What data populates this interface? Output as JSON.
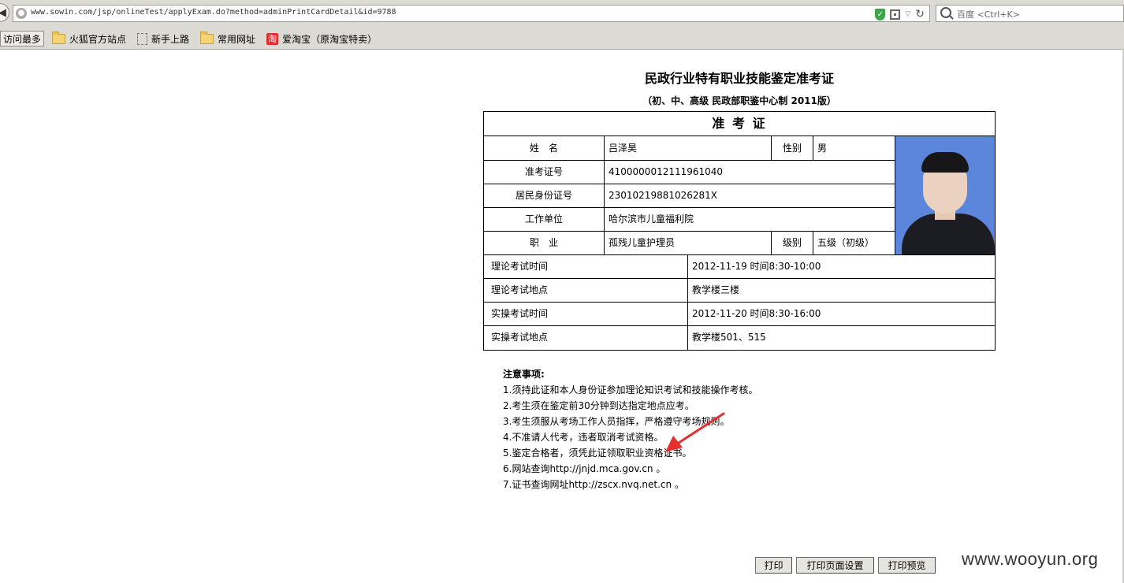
{
  "browser": {
    "url": "www.sowin.com/jsp/onlineTest/applyExam.do?method=adminPrintCardDetail&id=9788",
    "search_placeholder": "百度 <Ctrl+K>",
    "bookmarks": [
      "访问最多",
      "火狐官方站点",
      "新手上路",
      "常用网址",
      "爱淘宝（原淘宝特卖）"
    ]
  },
  "card": {
    "title": "民政行业特有职业技能鉴定准考证",
    "subtitle": "（初、中、高级 民政部职鉴中心制 2011版）",
    "heading": "准 考 证",
    "name_label": "姓　名",
    "name": "吕泽昊",
    "gender_label": "性别",
    "gender": "男",
    "ticket_label": "准考证号",
    "ticket_no": "4100000012111961040",
    "id_label": "居民身份证号",
    "id_no": "23010219881026281X",
    "employer_label": "工作单位",
    "employer": "哈尔滨市儿童福利院",
    "occupation_label": "职　业",
    "occupation": "孤残儿童护理员",
    "level_label": "级别",
    "level": "五级（初级）",
    "schedule": [
      {
        "label": "理论考试时间",
        "value": "2012-11-19  时间8:30-10:00"
      },
      {
        "label": "理论考试地点",
        "value": "教学楼三楼"
      },
      {
        "label": "实操考试时间",
        "value": "2012-11-20  时间8:30-16:00"
      },
      {
        "label": "实操考试地点",
        "value": "教学楼501、515"
      }
    ]
  },
  "notes": {
    "heading": "注意事项:",
    "items": [
      "1.须持此证和本人身份证参加理论知识考试和技能操作考核。",
      "2.考生须在鉴定前30分钟到达指定地点应考。",
      "3.考生须服从考场工作人员指挥，严格遵守考场规则。",
      "4.不准请人代考，违者取消考试资格。",
      "5.鉴定合格者，须凭此证领取职业资格证书。",
      "6.网站查询http://jnjd.mca.gov.cn 。",
      "7.证书查询网址http://zscx.nvq.net.cn 。"
    ]
  },
  "buttons": {
    "print": "打印",
    "page_setup": "打印页面设置",
    "preview": "打印预览"
  },
  "watermark": "www.wooyun.org"
}
